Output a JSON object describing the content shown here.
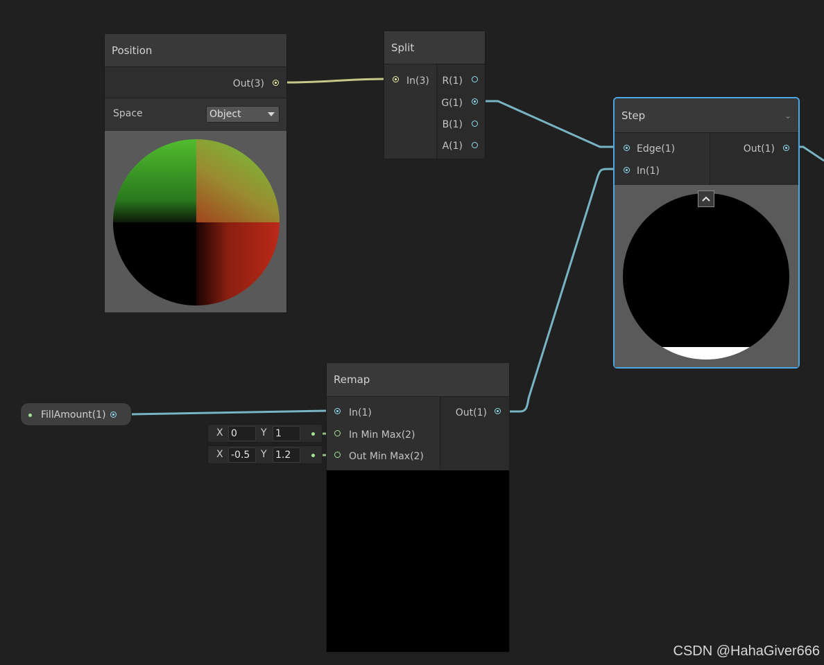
{
  "colors": {
    "background": "#202020",
    "vector3_port": "#f0eea5",
    "vector1_port": "#8fe0f0",
    "vector2_port": "#a6e495",
    "selection_border": "#4aa8e8"
  },
  "nodes": {
    "position": {
      "title": "Position",
      "out_label": "Out(3)",
      "space_label": "Space",
      "space_value": "Object"
    },
    "split": {
      "title": "Split",
      "in_label": "In(3)",
      "outputs": [
        "R(1)",
        "G(1)",
        "B(1)",
        "A(1)"
      ]
    },
    "step": {
      "title": "Step",
      "inputs": [
        "Edge(1)",
        "In(1)"
      ],
      "out_label": "Out(1)",
      "collapse_icon": "chevron-up-icon",
      "menu_icon": "chevron-down-icon"
    },
    "remap": {
      "title": "Remap",
      "inputs": [
        "In(1)",
        "In Min Max(2)",
        "Out Min Max(2)"
      ],
      "out_label": "Out(1)",
      "in_min_max": {
        "x_label": "X",
        "x_value": "0",
        "y_label": "Y",
        "y_value": "1"
      },
      "out_min_max": {
        "x_label": "X",
        "x_value": "-0.5",
        "y_label": "Y",
        "y_value": "1.2"
      }
    },
    "fill_amount": {
      "label": "FillAmount(1)"
    }
  },
  "watermark": "CSDN @HahaGiver666"
}
